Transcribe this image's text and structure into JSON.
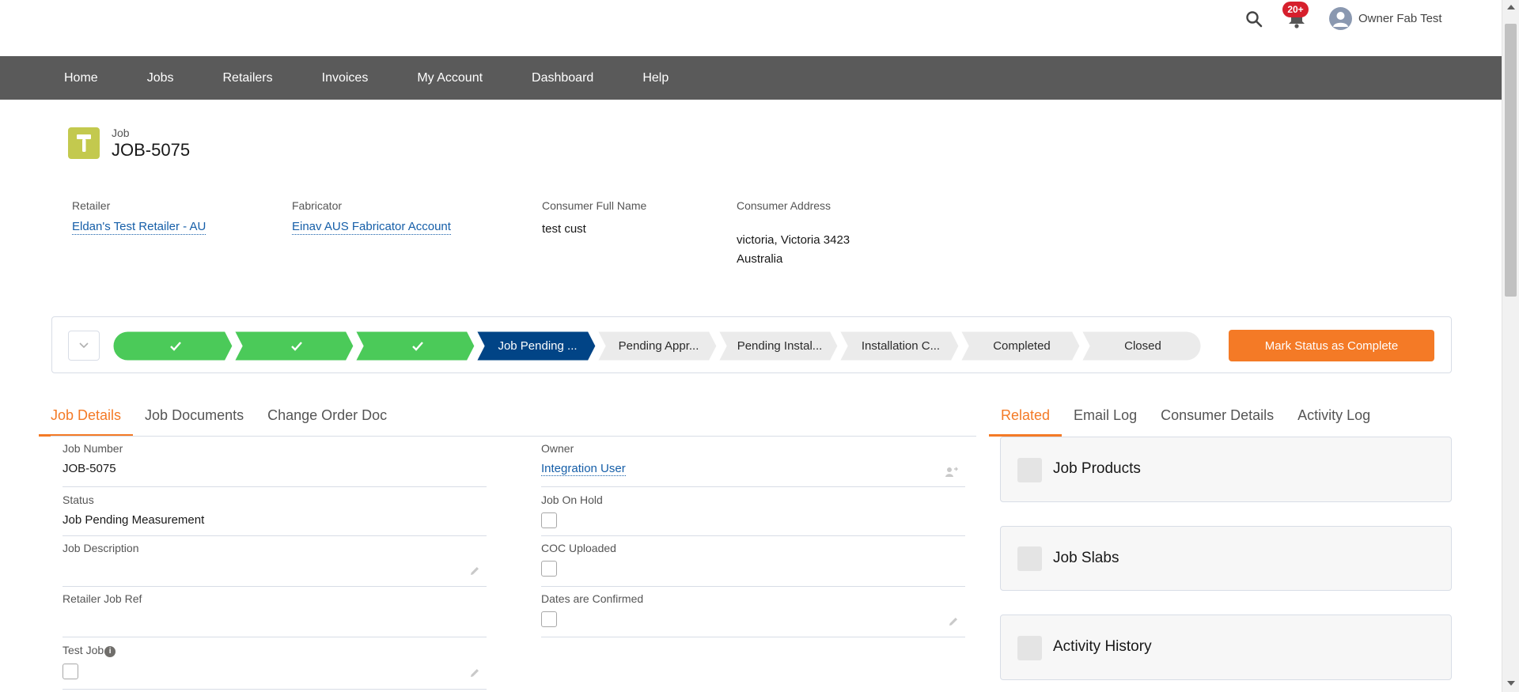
{
  "header": {
    "notification_count": "20+",
    "user_name": "Owner Fab Test"
  },
  "nav": {
    "items": [
      "Home",
      "Jobs",
      "Retailers",
      "Invoices",
      "My Account",
      "Dashboard",
      "Help"
    ]
  },
  "record": {
    "type_label": "Job",
    "name": "JOB-5075"
  },
  "highlights": {
    "retailer_label": "Retailer",
    "retailer_value": "Eldan's Test Retailer - AU",
    "fabricator_label": "Fabricator",
    "fabricator_value": "Einav AUS Fabricator Account",
    "consumer_name_label": "Consumer Full Name",
    "consumer_name_value": "test cust",
    "consumer_address_label": "Consumer Address",
    "consumer_address_line1": "victoria, Victoria 3423",
    "consumer_address_line2": "Australia"
  },
  "path": {
    "steps": [
      {
        "label": "",
        "state": "complete"
      },
      {
        "label": "",
        "state": "complete"
      },
      {
        "label": "",
        "state": "complete"
      },
      {
        "label": "Job Pending ...",
        "state": "current"
      },
      {
        "label": "Pending Appr...",
        "state": "pending"
      },
      {
        "label": "Pending Instal...",
        "state": "pending"
      },
      {
        "label": "Installation C...",
        "state": "pending"
      },
      {
        "label": "Completed",
        "state": "pending"
      },
      {
        "label": "Closed",
        "state": "pending"
      }
    ],
    "action_label": "Mark Status as Complete"
  },
  "colors": {
    "complete": "#4bca59",
    "current": "#014486",
    "pending": "#ebebeb",
    "accent": "#f47a26"
  },
  "tabs_left": [
    "Job Details",
    "Job Documents",
    "Change Order Doc"
  ],
  "tabs_right": [
    "Related",
    "Email Log",
    "Consumer Details",
    "Activity Log"
  ],
  "details": {
    "job_number_label": "Job Number",
    "job_number_value": "JOB-5075",
    "owner_label": "Owner",
    "owner_value": "Integration User",
    "status_label": "Status",
    "status_value": "Job Pending Measurement",
    "job_on_hold_label": "Job On Hold",
    "job_description_label": "Job Description",
    "coc_uploaded_label": "COC Uploaded",
    "retailer_job_ref_label": "Retailer Job Ref",
    "dates_confirmed_label": "Dates are Confirmed",
    "test_job_label": "Test Job"
  },
  "related": {
    "cards": [
      "Job Products",
      "Job Slabs",
      "Activity History"
    ]
  }
}
